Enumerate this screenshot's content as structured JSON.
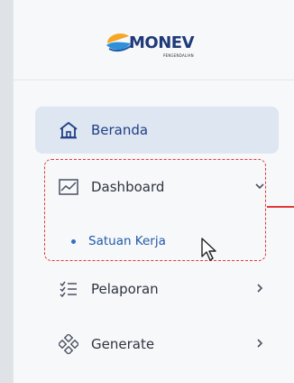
{
  "brand": {
    "logo_text": "MONEV",
    "logo_sub": "PENGENDALIAN",
    "colors": {
      "primary": "#1f3a7a",
      "accent": "#f5a623",
      "water": "#2f8fd8"
    }
  },
  "menu": {
    "items": [
      {
        "label": "Beranda",
        "icon": "home-icon",
        "active": true
      },
      {
        "label": "Dashboard",
        "icon": "chart-line-icon",
        "expanded": true
      },
      {
        "label": "Pelaporan",
        "icon": "checklist-icon"
      },
      {
        "label": "Generate",
        "icon": "diamond-grid-icon"
      }
    ],
    "dashboard_sub": [
      {
        "label": "Satuan Kerja"
      }
    ]
  },
  "annotation": {
    "color": "#e23a3a"
  }
}
